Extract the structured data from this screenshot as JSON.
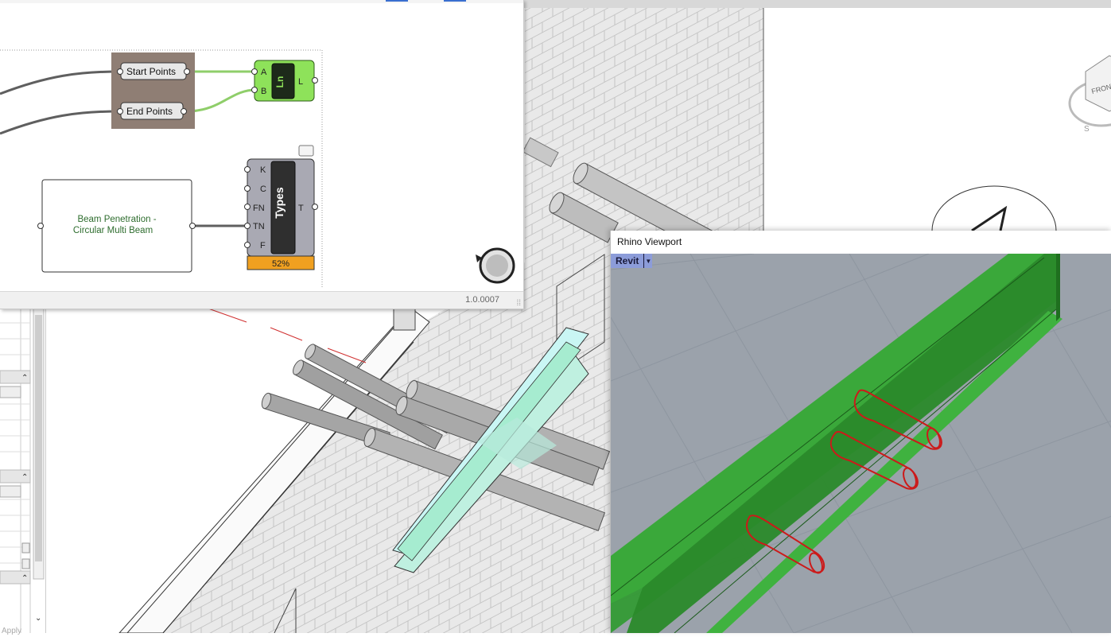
{
  "grasshopper": {
    "start_points_label": "Start Points",
    "end_points_label": "End Points",
    "line_component": {
      "icon": "Ln",
      "inputs": [
        "A",
        "B"
      ],
      "outputs": [
        "L"
      ]
    },
    "types_component": {
      "name": "Types",
      "inputs": [
        "K",
        "C",
        "FN",
        "TN",
        "F"
      ],
      "outputs": [
        "T"
      ],
      "progress": "52%"
    },
    "panel": {
      "line1": "Beam Penetration -",
      "line2": "Circular Multi Beam"
    },
    "version": "1.0.0007",
    "colors": {
      "group": "#8f7e74",
      "line_component": "#8ee25a",
      "progress": "#f0a020",
      "active_wire": "#8fce6a",
      "wire": "#606060"
    }
  },
  "revit": {
    "viewcube_face": "FRONT",
    "apply_label": "Apply"
  },
  "rhino": {
    "title": "Rhino Viewport",
    "viewport_name": "Revit",
    "colors": {
      "background": "#9ba2ab",
      "beam": "#3aa83a",
      "pipes": "#cc1a1a",
      "tab": "#8c9cd9"
    }
  }
}
